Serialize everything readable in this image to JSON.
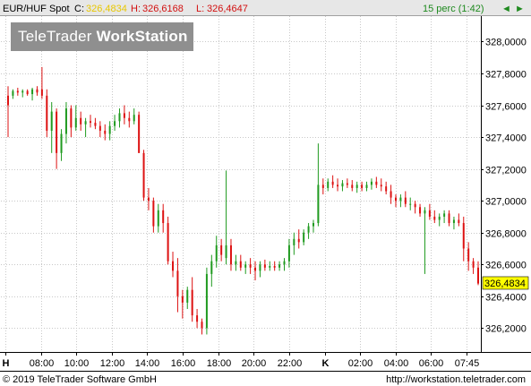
{
  "header": {
    "symbol": "EUR/HUF Spot",
    "close_prefix": "C:",
    "close": "326,4834",
    "high_prefix": "H:",
    "high": "326,6168",
    "low_prefix": "L:",
    "low": "326,4647",
    "interval": "15 perc (1:42)",
    "nav_prev": "◄",
    "nav_next": "►"
  },
  "logo": {
    "part1": "TeleTrader",
    "part2": "WorkStation"
  },
  "footer": {
    "copyright": "© 2019 TeleTrader Software GmbH",
    "url": "http://workstation.teletrader.com"
  },
  "colors": {
    "up": "#1f9a1f",
    "down": "#dd1111",
    "grid": "#c8c8c8",
    "last_price_bg": "#ffff00",
    "header_close": "#e8c700",
    "header_high": "#d21010",
    "header_low": "#d21010",
    "header_interval": "#1f8a1f"
  },
  "chart_data": {
    "type": "candlestick",
    "ylim": [
      326.05,
      328.16
    ],
    "y_ticks": [
      "326,2000",
      "326,4000",
      "326,6000",
      "326,8000",
      "327,0000",
      "327,2000",
      "327,4000",
      "327,6000",
      "327,8000",
      "328,0000"
    ],
    "last_price_label": "326,4834",
    "x_labels": [
      "H",
      "08:00",
      "10:00",
      "12:00",
      "14:00",
      "16:00",
      "18:00",
      "20:00",
      "22:00",
      "K",
      "02:00",
      "04:00",
      "06:00",
      "07:45"
    ],
    "candles": [
      [
        327.66,
        327.72,
        327.4,
        327.6
      ],
      [
        327.66,
        327.7,
        327.64,
        327.69
      ],
      [
        327.69,
        327.71,
        327.66,
        327.68
      ],
      [
        327.68,
        327.7,
        327.65,
        327.69
      ],
      [
        327.69,
        327.7,
        327.66,
        327.67
      ],
      [
        327.67,
        327.71,
        327.63,
        327.7
      ],
      [
        327.7,
        327.72,
        327.66,
        327.68
      ],
      [
        327.7,
        327.84,
        327.64,
        327.66
      ],
      [
        327.66,
        327.7,
        327.4,
        327.44
      ],
      [
        327.44,
        327.62,
        327.3,
        327.56
      ],
      [
        327.56,
        327.58,
        327.2,
        327.3
      ],
      [
        327.3,
        327.45,
        327.25,
        327.42
      ],
      [
        327.42,
        327.62,
        327.36,
        327.58
      ],
      [
        327.58,
        327.6,
        327.4,
        327.46
      ],
      [
        327.46,
        327.6,
        327.44,
        327.52
      ],
      [
        327.52,
        327.56,
        327.44,
        327.48
      ],
      [
        327.48,
        327.52,
        327.4,
        327.5
      ],
      [
        327.5,
        327.54,
        327.46,
        327.49
      ],
      [
        327.49,
        327.52,
        327.45,
        327.47
      ],
      [
        327.47,
        327.5,
        327.4,
        327.44
      ],
      [
        327.44,
        327.48,
        327.38,
        327.42
      ],
      [
        327.42,
        327.5,
        327.38,
        327.47
      ],
      [
        327.47,
        327.54,
        327.44,
        327.5
      ],
      [
        327.5,
        327.58,
        327.46,
        327.55
      ],
      [
        327.55,
        327.6,
        327.48,
        327.52
      ],
      [
        327.52,
        327.56,
        327.46,
        327.5
      ],
      [
        327.5,
        327.58,
        327.48,
        327.54
      ],
      [
        327.54,
        327.56,
        327.3,
        327.3
      ],
      [
        327.3,
        327.32,
        327.0,
        327.02
      ],
      [
        327.02,
        327.08,
        326.94,
        327.0
      ],
      [
        327.0,
        327.02,
        326.8,
        326.84
      ],
      [
        326.84,
        326.98,
        326.8,
        326.94
      ],
      [
        326.94,
        326.98,
        326.8,
        326.86
      ],
      [
        326.86,
        326.9,
        326.6,
        326.62
      ],
      [
        326.62,
        326.68,
        326.52,
        326.56
      ],
      [
        326.56,
        326.64,
        326.3,
        326.4
      ],
      [
        326.4,
        326.44,
        326.26,
        326.36
      ],
      [
        326.36,
        326.46,
        326.32,
        326.44
      ],
      [
        326.44,
        326.52,
        326.24,
        326.28
      ],
      [
        326.28,
        326.32,
        326.2,
        326.24
      ],
      [
        326.24,
        326.26,
        326.16,
        326.2
      ],
      [
        326.2,
        326.58,
        326.16,
        326.54
      ],
      [
        326.54,
        326.66,
        326.46,
        326.62
      ],
      [
        326.62,
        326.78,
        326.58,
        326.72
      ],
      [
        326.72,
        326.76,
        326.62,
        326.66
      ],
      [
        326.64,
        327.19,
        326.6,
        326.72
      ],
      [
        326.72,
        326.76,
        326.56,
        326.6
      ],
      [
        326.6,
        326.66,
        326.56,
        326.62
      ],
      [
        326.62,
        326.66,
        326.56,
        326.58
      ],
      [
        326.58,
        326.62,
        326.54,
        326.6
      ],
      [
        326.6,
        326.64,
        326.54,
        326.58
      ],
      [
        326.58,
        326.62,
        326.5,
        326.56
      ],
      [
        326.56,
        326.62,
        326.52,
        326.6
      ],
      [
        326.6,
        326.63,
        326.56,
        326.58
      ],
      [
        326.58,
        326.62,
        326.56,
        326.59
      ],
      [
        326.59,
        326.62,
        326.56,
        326.58
      ],
      [
        326.58,
        326.62,
        326.56,
        326.6
      ],
      [
        326.6,
        326.64,
        326.56,
        326.62
      ],
      [
        326.62,
        326.76,
        326.58,
        326.72
      ],
      [
        326.72,
        326.8,
        326.66,
        326.76
      ],
      [
        326.76,
        326.82,
        326.7,
        326.74
      ],
      [
        326.74,
        326.82,
        326.72,
        326.8
      ],
      [
        326.8,
        326.86,
        326.76,
        326.84
      ],
      [
        326.84,
        326.88,
        326.8,
        326.86
      ],
      [
        326.86,
        327.36,
        326.84,
        327.1
      ],
      [
        327.1,
        327.14,
        327.04,
        327.08
      ],
      [
        327.08,
        327.14,
        327.06,
        327.12
      ],
      [
        327.12,
        327.16,
        327.08,
        327.1
      ],
      [
        327.1,
        327.14,
        327.06,
        327.09
      ],
      [
        327.09,
        327.13,
        327.06,
        327.11
      ],
      [
        327.11,
        327.14,
        327.08,
        327.1
      ],
      [
        327.1,
        327.13,
        327.06,
        327.08
      ],
      [
        327.08,
        327.12,
        327.05,
        327.1
      ],
      [
        327.1,
        327.12,
        327.06,
        327.08
      ],
      [
        327.08,
        327.12,
        327.06,
        327.1
      ],
      [
        327.1,
        327.14,
        327.07,
        327.12
      ],
      [
        327.12,
        327.15,
        327.08,
        327.1
      ],
      [
        327.1,
        327.14,
        327.06,
        327.09
      ],
      [
        327.09,
        327.12,
        327.04,
        327.06
      ],
      [
        327.06,
        327.1,
        326.98,
        327.02
      ],
      [
        327.02,
        327.04,
        326.96,
        327.0
      ],
      [
        327.0,
        327.04,
        326.96,
        327.02
      ],
      [
        327.02,
        327.06,
        326.96,
        326.98
      ],
      [
        326.98,
        327.02,
        326.94,
        326.98
      ],
      [
        326.98,
        327.0,
        326.92,
        326.96
      ],
      [
        326.96,
        326.98,
        326.9,
        326.92
      ],
      [
        326.92,
        326.96,
        326.54,
        326.94
      ],
      [
        326.94,
        326.98,
        326.88,
        326.9
      ],
      [
        326.9,
        326.94,
        326.86,
        326.88
      ],
      [
        326.88,
        326.92,
        326.84,
        326.9
      ],
      [
        326.9,
        326.94,
        326.86,
        326.92
      ],
      [
        326.92,
        326.94,
        326.84,
        326.86
      ],
      [
        326.86,
        326.9,
        326.82,
        326.88
      ],
      [
        326.88,
        326.92,
        326.84,
        326.86
      ],
      [
        326.86,
        326.9,
        326.62,
        326.7
      ],
      [
        326.7,
        326.74,
        326.56,
        326.62
      ],
      [
        326.62,
        326.64,
        326.54,
        326.58
      ],
      [
        326.58,
        326.62,
        326.47,
        326.48
      ]
    ]
  }
}
